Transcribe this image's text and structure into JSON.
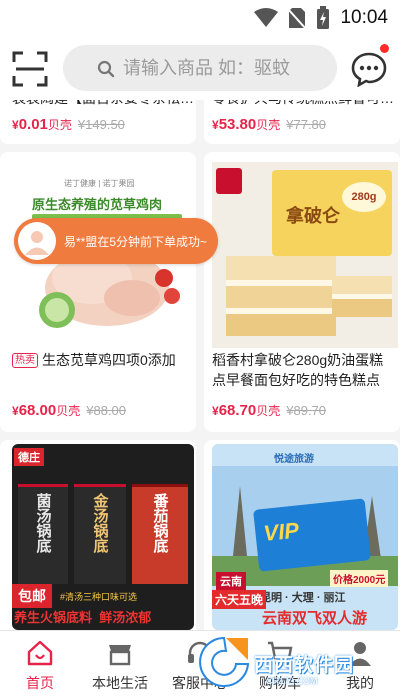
{
  "status": {
    "time": "10:04"
  },
  "search": {
    "placeholder": "请输入商品 如：驱蚊"
  },
  "top_partial": [
    {
      "title": "袁袁阔建【面吉茶姜冬茶祛…",
      "price": "0.01",
      "orig": "¥149.50"
    },
    {
      "title": "零食扩兵马传统糕点鲜香可…",
      "price": "53.80",
      "orig": "¥77.80"
    }
  ],
  "products": [
    {
      "title": "生态苋草鸡四项0添加",
      "tag": "热卖",
      "price": "68.00",
      "orig": "¥88.00",
      "banner": "原生态养殖的苋草鸡肉",
      "brand": "诺丁健康 | 诺丁果园"
    },
    {
      "title": "稻香村拿破仑280g奶油蛋糕点早餐面包好吃的特色糕点点…",
      "price": "68.70",
      "orig": "¥89.70",
      "box_text": "拿破仑",
      "badge": "280g"
    },
    {
      "badge": "包邮",
      "brand": "德庄",
      "pack_labels": [
        "菌汤锅底",
        "金汤锅底",
        "番茄锅底"
      ],
      "promo": "#清汤三种口味可选",
      "slogan": "养生火锅底料  鲜汤浓郁"
    },
    {
      "agency": "悦途旅游",
      "region": "云南",
      "route": "昆明 · 大理 · 丽江",
      "days": "六天五晚",
      "vip": "VIP",
      "price_tag": "价格2000元",
      "slogan": "云南双飞双人游"
    }
  ],
  "unit_label": "贝壳",
  "currency": "¥",
  "toast": {
    "text": "易**盟在5分钟前下单成功~"
  },
  "nav": {
    "items": [
      {
        "label": "首页",
        "active": true
      },
      {
        "label": "本地生活"
      },
      {
        "label": "客服中心"
      },
      {
        "label": "购物车"
      },
      {
        "label": "我的"
      }
    ]
  },
  "watermark": {
    "text": "西西软件园",
    "url": "CR173.COM"
  },
  "colors": {
    "accent": "#e6244b",
    "toast": "#f07b3f"
  }
}
